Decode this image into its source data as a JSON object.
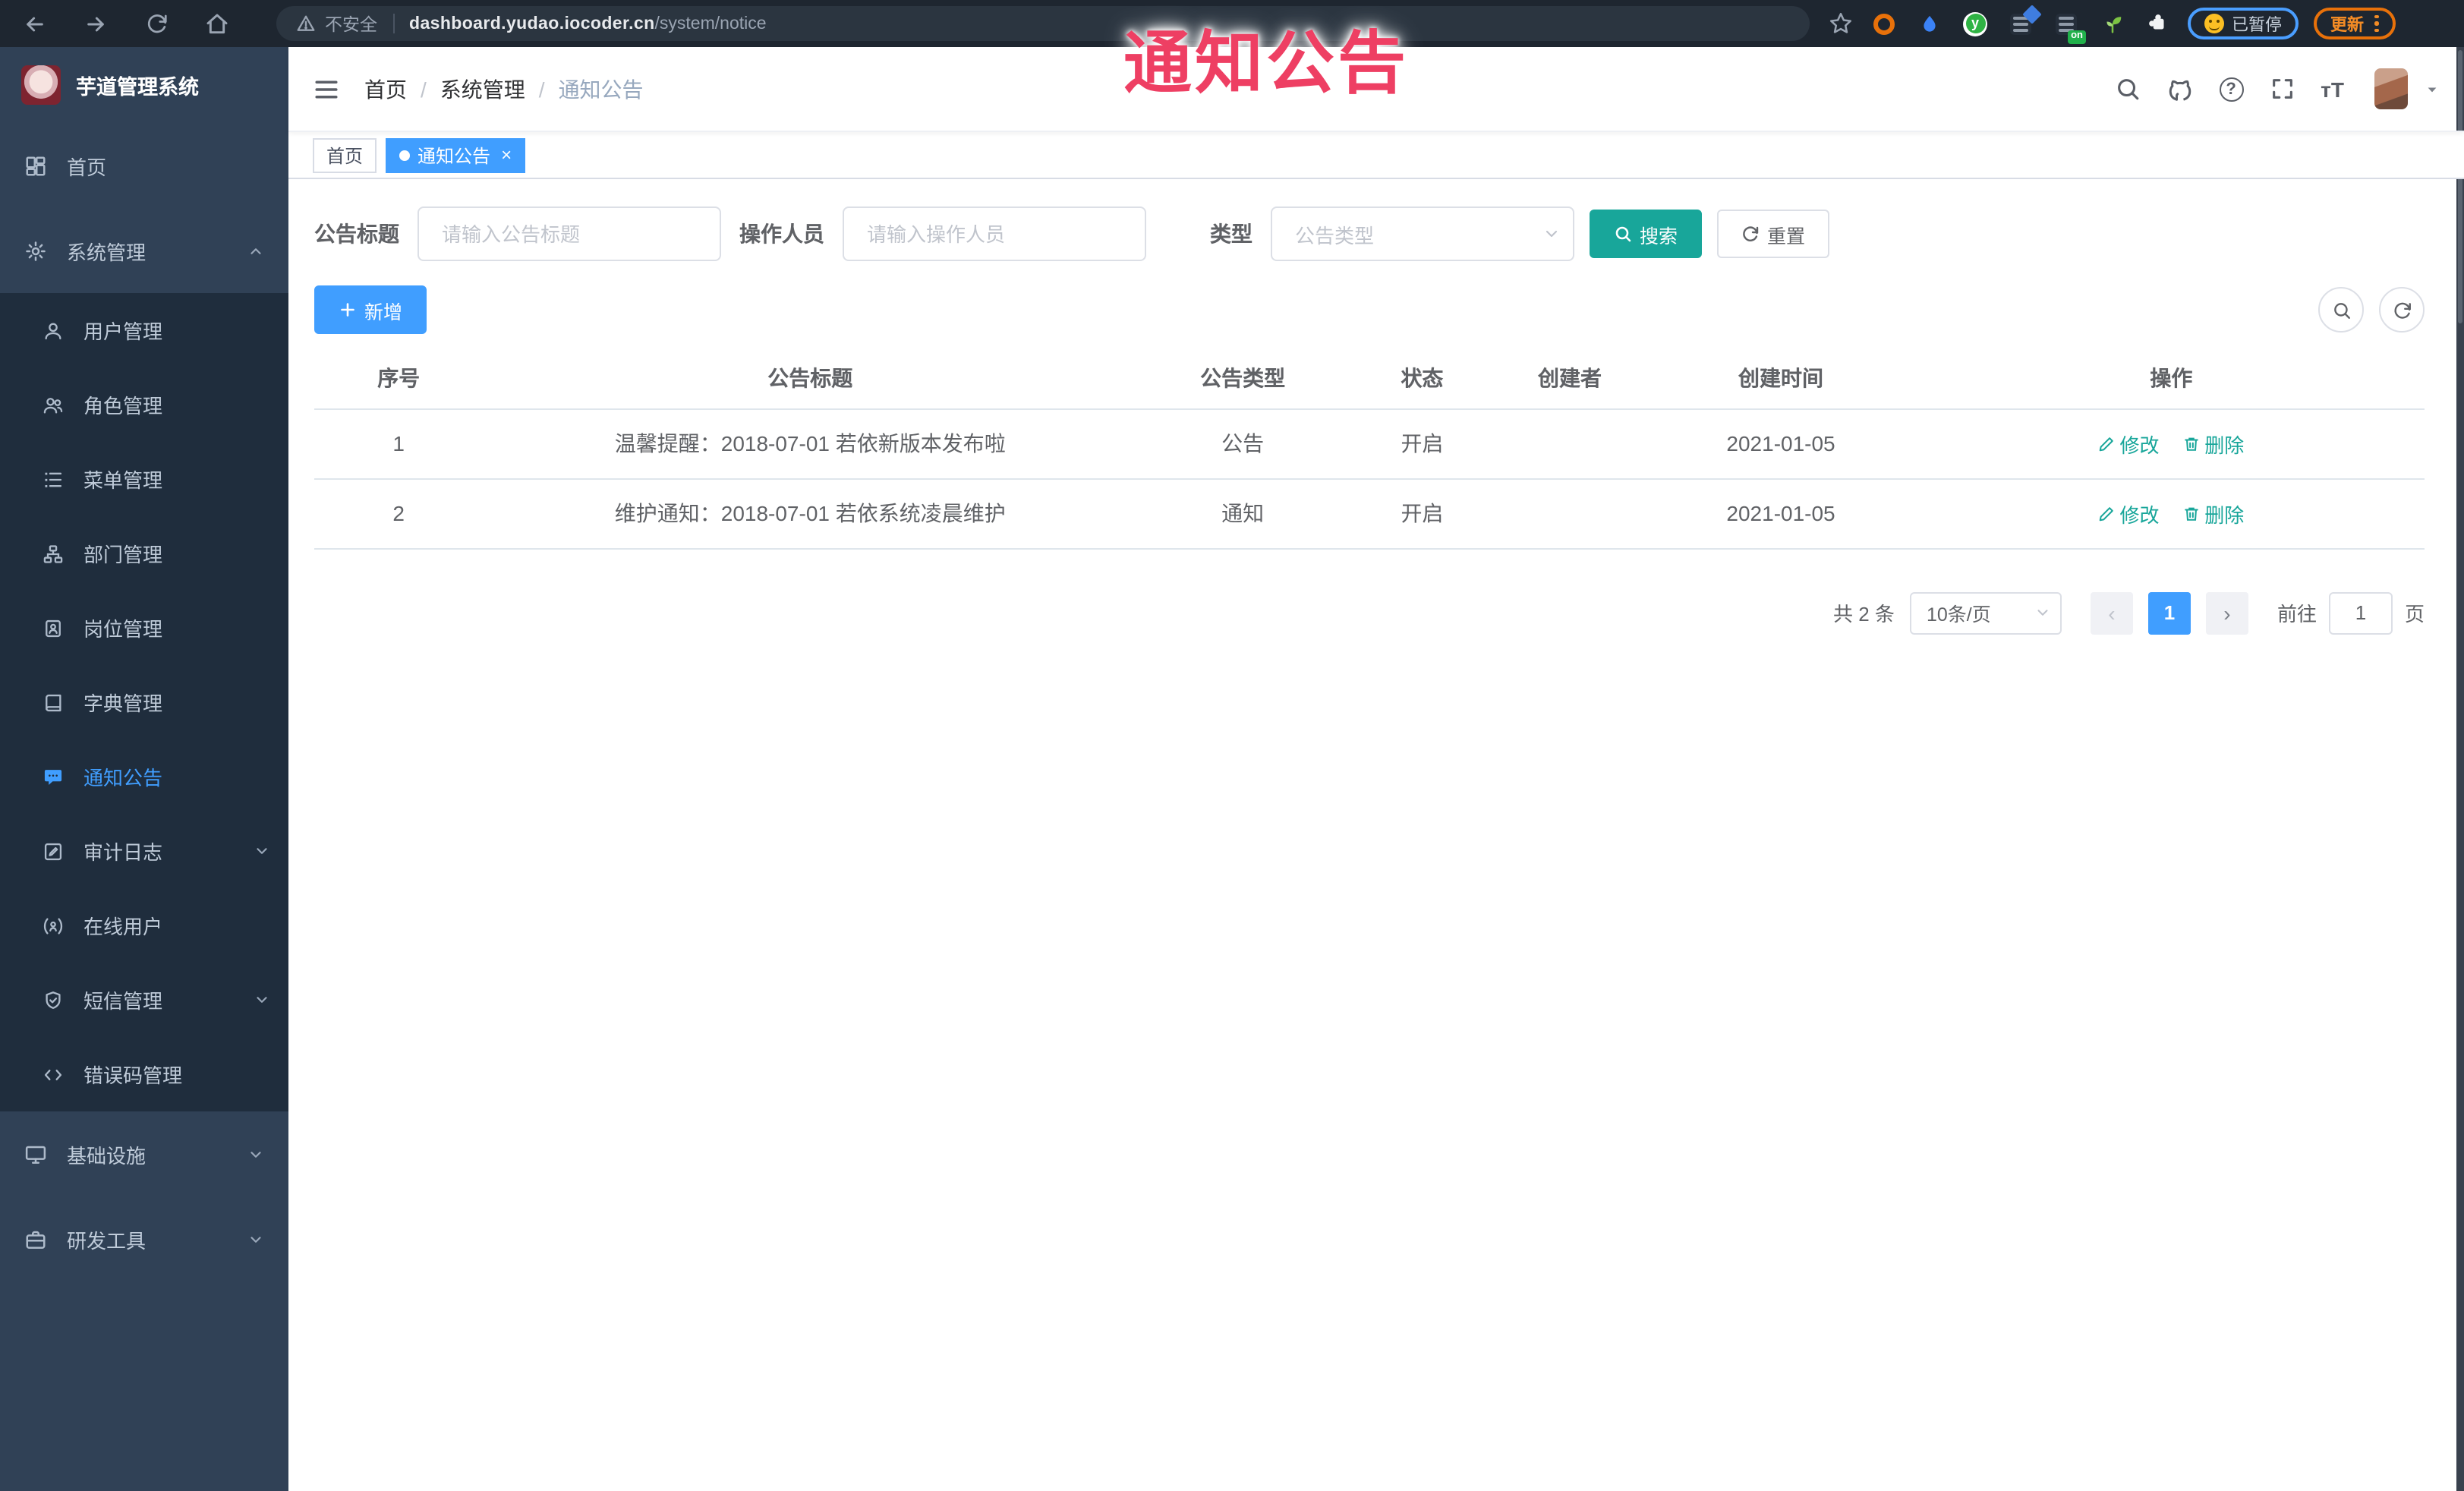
{
  "browser": {
    "security_label": "不安全",
    "url_host": "dashboard.yudao.iocoder.cn",
    "url_path": "/system/notice",
    "extension_y_letter": "y",
    "extension_on_badge": "on",
    "paused_label": "已暂停",
    "update_label": "更新"
  },
  "overlay": {
    "text": "通知公告"
  },
  "sidebar": {
    "title": "芋道管理系统",
    "home": "首页",
    "system": "系统管理",
    "submenu": [
      "用户管理",
      "角色管理",
      "菜单管理",
      "部门管理",
      "岗位管理",
      "字典管理",
      "通知公告",
      "审计日志",
      "在线用户",
      "短信管理",
      "错误码管理"
    ],
    "active_item": "通知公告",
    "infra": "基础设施",
    "devtools": "研发工具"
  },
  "navbar": {
    "breadcrumb": [
      "首页",
      "系统管理",
      "通知公告"
    ]
  },
  "tags": {
    "home": "首页",
    "active": "通知公告",
    "close_glyph": "×"
  },
  "filter": {
    "title_label": "公告标题",
    "title_placeholder": "请输入公告标题",
    "operator_label": "操作人员",
    "operator_placeholder": "请输入操作人员",
    "type_label": "类型",
    "type_placeholder": "公告类型",
    "search_label": "搜索",
    "reset_label": "重置"
  },
  "toolbar": {
    "add_label": "新增"
  },
  "table": {
    "headers": [
      "序号",
      "公告标题",
      "公告类型",
      "状态",
      "创建者",
      "创建时间",
      "操作"
    ],
    "edit_label": "修改",
    "delete_label": "删除",
    "rows": [
      {
        "no": "1",
        "title": "温馨提醒：2018-07-01 若依新版本发布啦",
        "type": "公告",
        "status": "开启",
        "creator": "",
        "created": "2021-01-05"
      },
      {
        "no": "2",
        "title": "维护通知：2018-07-01 若依系统凌晨维护",
        "type": "通知",
        "status": "开启",
        "creator": "",
        "created": "2021-01-05"
      }
    ]
  },
  "pagination": {
    "total": "共 2 条",
    "page_size": "10条/页",
    "prev": "‹",
    "current": "1",
    "next": "›",
    "goto_label": "前往",
    "goto_value": "1",
    "page_unit": "页"
  },
  "colors": {
    "primary_blue": "#409eff",
    "theme_teal": "#18a69a",
    "sidebar_bg": "#304156",
    "submenu_bg": "#1f2d3d",
    "overlay_pink": "#ee3f63",
    "browser_bar_bg": "#1e2630"
  }
}
